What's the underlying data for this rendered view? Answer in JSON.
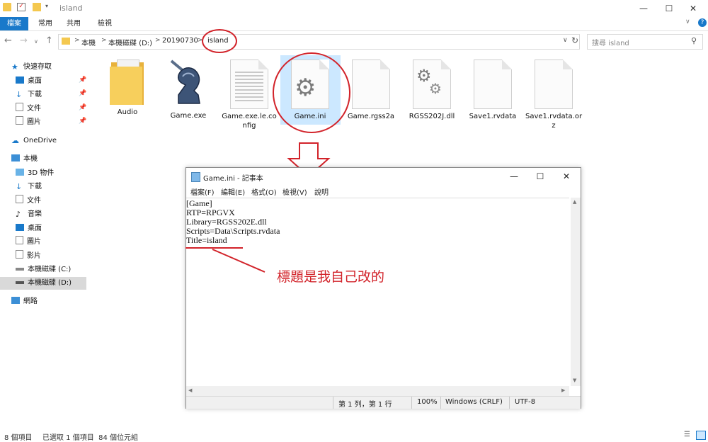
{
  "window": {
    "title": "island",
    "minimize": "—",
    "maximize": "☐",
    "close": "✕"
  },
  "ribbon": {
    "tabs": [
      "檔案",
      "常用",
      "共用",
      "檢視"
    ]
  },
  "address": {
    "crumbs": [
      "本機",
      "本機磁碟 (D:)",
      "20190730",
      "island"
    ],
    "search_placeholder": "搜尋 island"
  },
  "nav": {
    "quick_access": "快速存取",
    "quick_items": [
      "桌面",
      "下載",
      "文件",
      "圖片"
    ],
    "onedrive": "OneDrive",
    "this_pc": "本機",
    "pc_items": [
      "3D 物件",
      "下載",
      "文件",
      "音樂",
      "桌面",
      "圖片",
      "影片",
      "本機磁碟 (C:)",
      "本機磁碟 (D:)"
    ],
    "network": "網路"
  },
  "files": [
    {
      "name": "Audio",
      "icon": "folder-icon"
    },
    {
      "name": "Game.exe",
      "icon": "knight-app-icon"
    },
    {
      "name": "Game.exe.le.co\nnfig",
      "icon": "text-file-icon"
    },
    {
      "name": "Game.ini",
      "icon": "settings-file-icon"
    },
    {
      "name": "Game.rgss2a",
      "icon": "file-icon"
    },
    {
      "name": "RGSS202J.dll",
      "icon": "dll-gears-icon"
    },
    {
      "name": "Save1.rvdata",
      "icon": "file-icon"
    },
    {
      "name": "Save1.rvdata.or\nz",
      "icon": "file-icon"
    }
  ],
  "notepad": {
    "title": "Game.ini - 記事本",
    "menu": [
      "檔案(F)",
      "編輯(E)",
      "格式(O)",
      "檢視(V)",
      "說明"
    ],
    "lines": [
      "[Game]",
      "RTP=RPGVX",
      "Library=RGSS202E.dll",
      "Scripts=Data\\Scripts.rvdata",
      "Title=island"
    ],
    "status": {
      "position": "第 1 列，第 1 行",
      "zoom": "100%",
      "line_ending": "Windows (CRLF)",
      "encoding": "UTF-8"
    }
  },
  "annotation": {
    "text": "標題是我自己改的",
    "color": "#d2232a"
  },
  "statusbar": {
    "items": "8 個項目",
    "selected": "已選取 1 個項目  84 個位元組"
  },
  "colors": {
    "accent": "#1979ca",
    "selection": "#cce8ff",
    "annotation_red": "#d2232a"
  }
}
